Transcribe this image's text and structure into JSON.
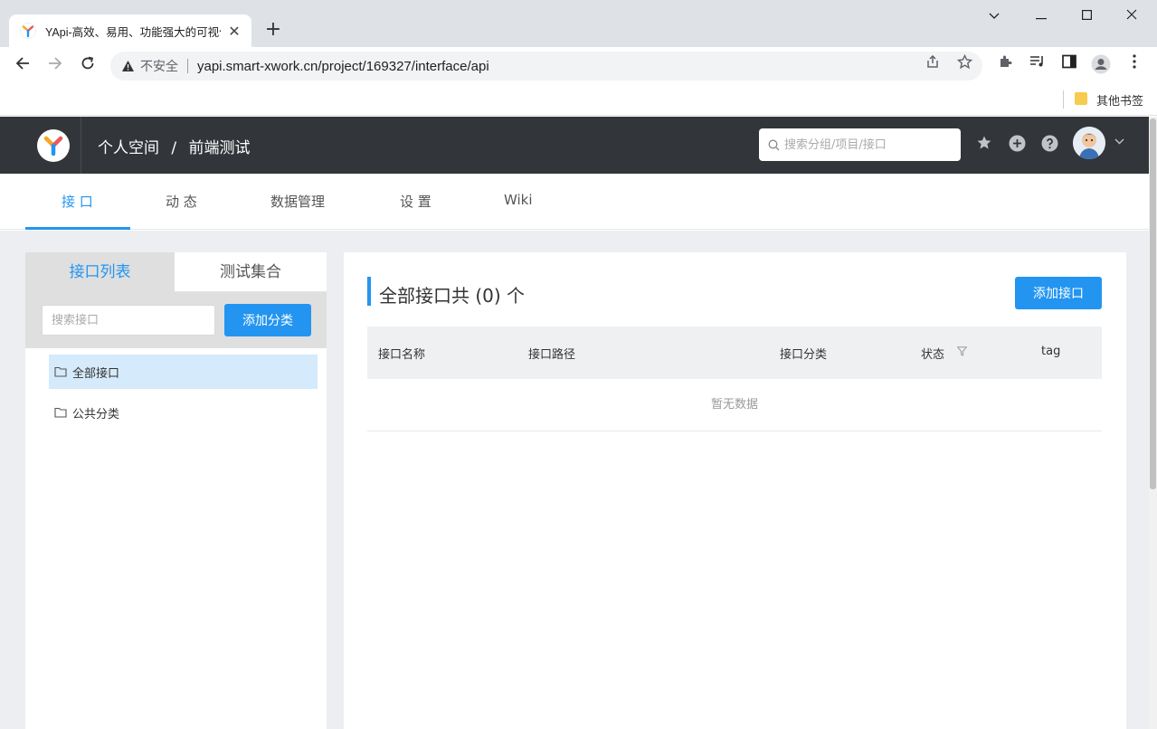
{
  "browser": {
    "tab_title": "YApi-高效、易用、功能强大的可视化接口管理平台",
    "tab_close": "✕",
    "new_tab": "+",
    "security_label": "不安全",
    "url": "yapi.smart-xwork.cn/project/169327/interface/api",
    "bookmarks_other": "其他书签"
  },
  "header": {
    "breadcrumb_space": "个人空间",
    "breadcrumb_sep": "/",
    "breadcrumb_project": "前端测试",
    "search_placeholder": "搜索分组/项目/接口"
  },
  "subnav": {
    "items": [
      "接 口",
      "动 态",
      "数据管理",
      "设 置",
      "Wiki"
    ]
  },
  "left_panel": {
    "tabs": [
      "接口列表",
      "测试集合"
    ],
    "search_placeholder": "搜索接口",
    "add_category_label": "添加分类",
    "tree": [
      "全部接口",
      "公共分类"
    ]
  },
  "main": {
    "title": "全部接口共 (0) 个",
    "add_button_label": "添加接口",
    "columns": [
      "接口名称",
      "接口路径",
      "接口分类",
      "状态",
      "tag"
    ],
    "empty_text": "暂无数据"
  },
  "colors": {
    "accent": "#2395f1",
    "header_bg": "#32363a",
    "selected_row": "#d5eafb"
  }
}
